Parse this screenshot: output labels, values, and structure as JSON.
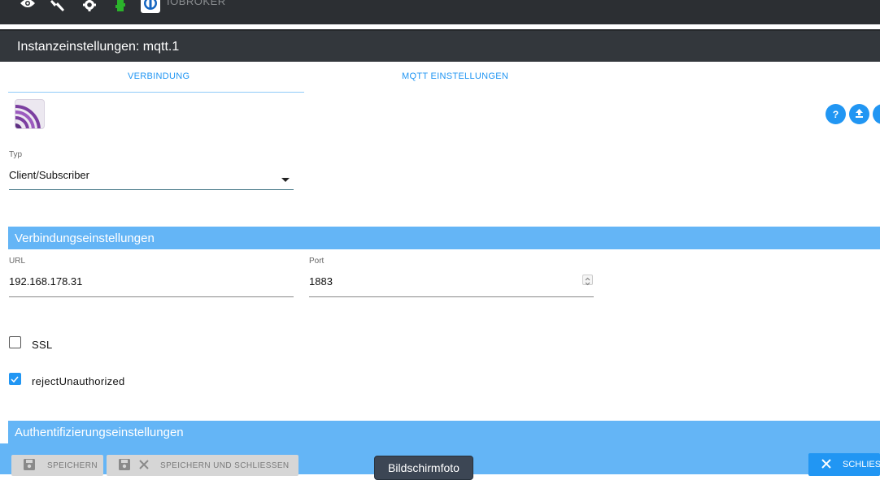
{
  "topbar": {
    "brand": "IOBROKER",
    "icons": [
      "eye-icon",
      "wrench-icon",
      "gear-icon",
      "adapter-icon",
      "logo-icon"
    ]
  },
  "dialog": {
    "title": "Instanzeinstellungen: mqtt.1"
  },
  "tabs": [
    {
      "label": "VERBINDUNG",
      "active": true
    },
    {
      "label": "MQTT EINSTELLUNGEN",
      "active": false
    }
  ],
  "type_field": {
    "label": "Typ",
    "value": "Client/Subscriber"
  },
  "sections": {
    "connection": "Verbindungseinstellungen",
    "auth": "Authentifizierungseinstellungen"
  },
  "url_field": {
    "label": "URL",
    "value": "192.168.178.31"
  },
  "port_field": {
    "label": "Port",
    "value": "1883"
  },
  "checkboxes": [
    {
      "label": "SSL",
      "checked": false
    },
    {
      "label": "rejectUnauthorized",
      "checked": true
    }
  ],
  "buttons": {
    "save": "SPEICHERN",
    "save_close": "SPEICHERN UND SCHLIESSEN",
    "close": "SCHLIESS"
  },
  "screenshot_badge": "Bildschirmfoto",
  "colors": {
    "accent": "#2196f3",
    "section": "#64b5f6",
    "header": "#33373c"
  }
}
